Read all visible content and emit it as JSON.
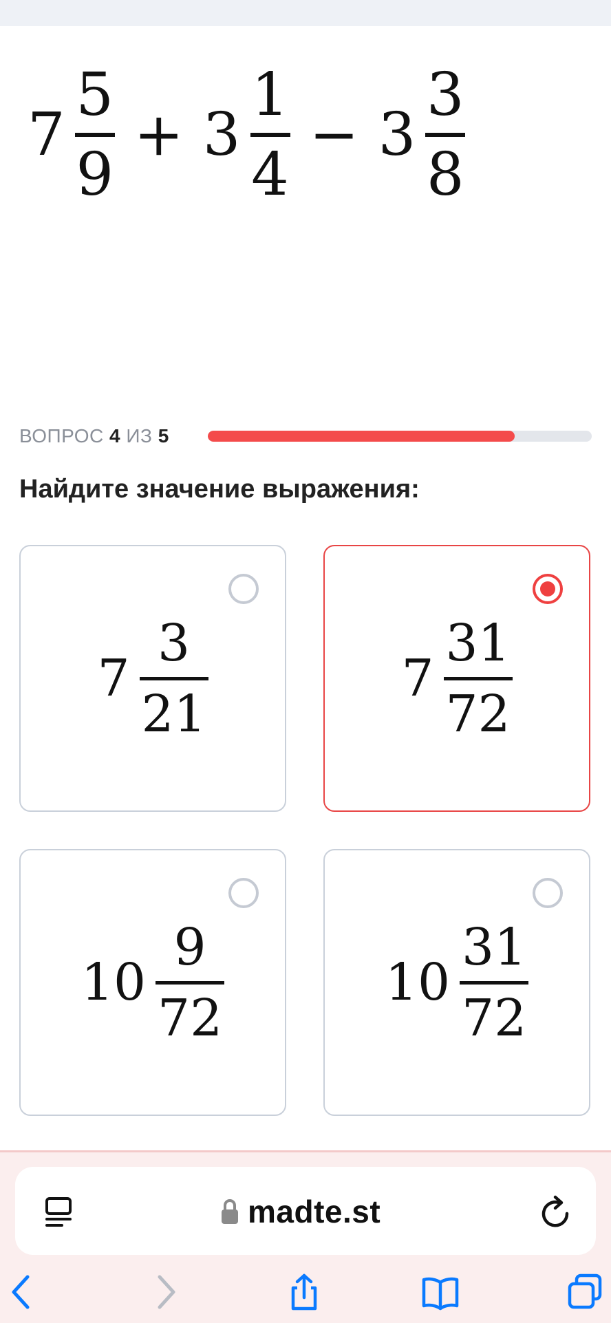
{
  "expression": {
    "term1": {
      "whole": "7",
      "num": "5",
      "den": "9"
    },
    "op1": "+",
    "term2": {
      "whole": "3",
      "num": "1",
      "den": "4"
    },
    "op2": "−",
    "term3": {
      "whole": "3",
      "num": "3",
      "den": "8"
    }
  },
  "progress": {
    "prefix": "ВОПРОС",
    "current": "4",
    "separator": "ИЗ",
    "total": "5",
    "fill_fraction": 0.8,
    "fill_color": "#f44b4b"
  },
  "question": "Найдите значение выражения:",
  "options": [
    {
      "whole": "7",
      "num": "3",
      "den": "21",
      "selected": false
    },
    {
      "whole": "7",
      "num": "31",
      "den": "72",
      "selected": true
    },
    {
      "whole": "10",
      "num": "9",
      "den": "72",
      "selected": false
    },
    {
      "whole": "10",
      "num": "31",
      "den": "72",
      "selected": false
    }
  ],
  "browser": {
    "url": "madte.st",
    "icons": [
      "reader-icon",
      "lock-icon",
      "reload-icon",
      "back-icon",
      "forward-icon",
      "share-icon",
      "bookmarks-icon",
      "tabs-icon"
    ],
    "accent_color": "#0a7aff"
  }
}
